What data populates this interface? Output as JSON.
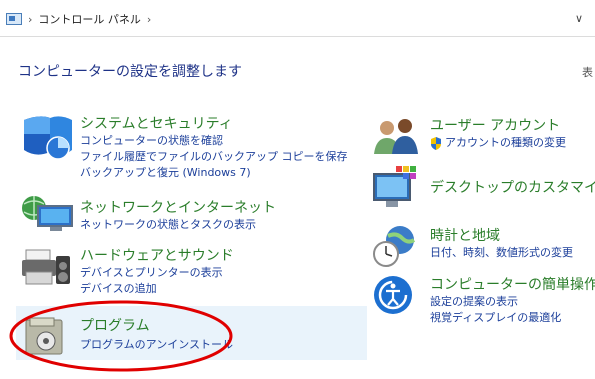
{
  "address_bar": {
    "icon": "control-panel-icon",
    "path": "コントロール パネル",
    "separator": "›"
  },
  "page": {
    "title": "コンピューターの設定を調整します",
    "view_by": "表"
  },
  "left_categories": [
    {
      "title": "システムとセキュリティ",
      "icon": "shield-icon",
      "links": [
        "コンピューターの状態を確認",
        "ファイル履歴でファイルのバックアップ コピーを保存",
        "バックアップと復元 (Windows 7)"
      ]
    },
    {
      "title": "ネットワークとインターネット",
      "icon": "network-icon",
      "links": [
        "ネットワークの状態とタスクの表示"
      ]
    },
    {
      "title": "ハードウェアとサウンド",
      "icon": "printer-icon",
      "links": [
        "デバイスとプリンターの表示",
        "デバイスの追加"
      ]
    },
    {
      "title": "プログラム",
      "icon": "programs-icon",
      "links": [
        "プログラムのアンインストール"
      ]
    }
  ],
  "right_categories": [
    {
      "title": "ユーザー アカウント",
      "icon": "users-icon",
      "links": [
        "アカウントの種類の変更"
      ]
    },
    {
      "title": "デスクトップのカスタマイズ",
      "icon": "monitor-icon",
      "links": []
    },
    {
      "title": "時計と地域",
      "icon": "clock-globe-icon",
      "links": [
        "日付、時刻、数値形式の変更"
      ]
    },
    {
      "title": "コンピューターの簡単操作",
      "icon": "ease-of-access-icon",
      "links": [
        "設定の提案の表示",
        "視覚ディスプレイの最適化"
      ]
    }
  ],
  "colors": {
    "title_green": "#2a7d2a",
    "link_blue": "#1c3f9a",
    "heading_blue": "#1e3287",
    "highlight": "#e9f3fb",
    "annotation_red": "#e00000"
  }
}
